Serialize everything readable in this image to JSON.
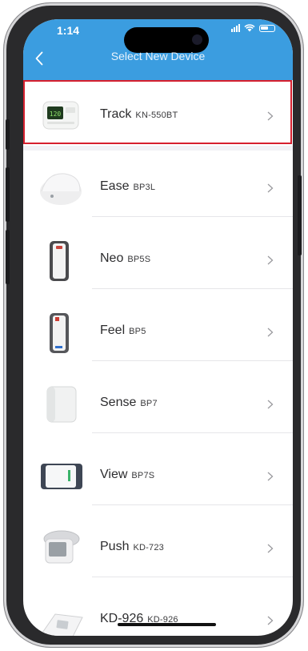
{
  "status_bar": {
    "time": "1:14"
  },
  "header": {
    "title": "Select New Device",
    "back_icon": "chevron-left-icon"
  },
  "devices": [
    {
      "name": "Track",
      "model": "KN-550BT"
    },
    {
      "name": "Ease",
      "model": "BP3L"
    },
    {
      "name": "Neo",
      "model": "BP5S"
    },
    {
      "name": "Feel",
      "model": "BP5"
    },
    {
      "name": "Sense",
      "model": "BP7"
    },
    {
      "name": "View",
      "model": "BP7S"
    },
    {
      "name": "Push",
      "model": "KD-723"
    },
    {
      "name": "KD-926",
      "model": "KD-926"
    }
  ],
  "colors": {
    "header": "#3b9de0",
    "highlight": "#d6202f"
  }
}
